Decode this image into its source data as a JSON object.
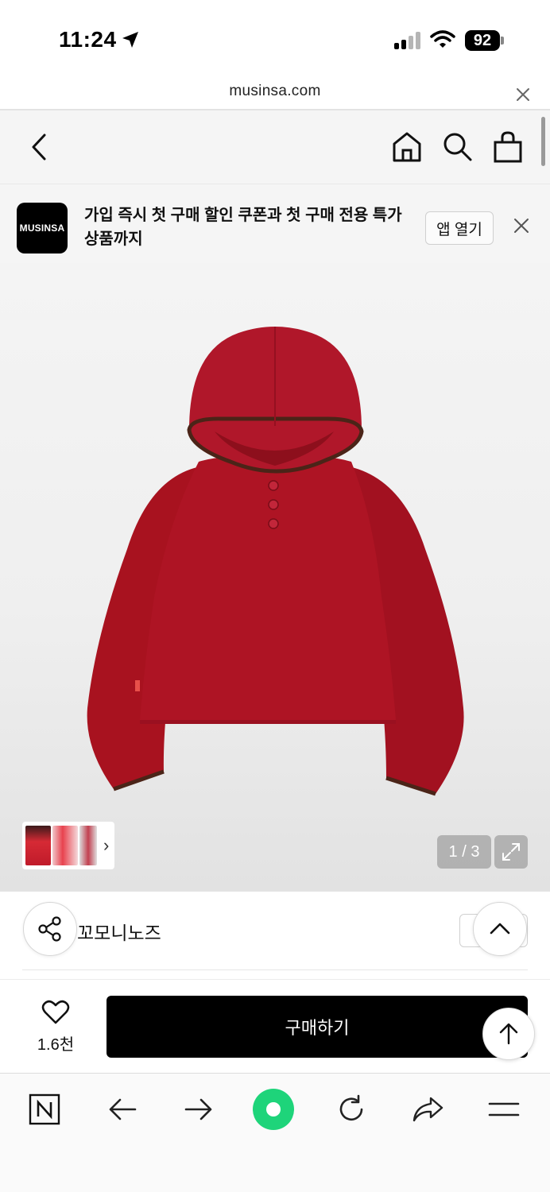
{
  "status_bar": {
    "time": "11:24",
    "battery": "92"
  },
  "browser": {
    "url": "musinsa.com"
  },
  "banner": {
    "logo_text": "MUSINSA",
    "message": "가입 즉시 첫 구매 할인 쿠폰과 첫 구매 전용 특가 상품까지",
    "open_app_label": "앱 열기"
  },
  "gallery": {
    "counter": "1 / 3"
  },
  "brand": {
    "name": "꼬모니노즈"
  },
  "purchase": {
    "like_count": "1.6천",
    "buy_label": "구매하기"
  },
  "colors": {
    "accent_green": "#1ed47a",
    "product_red": "#a8121f",
    "trim_brown": "#4b2418"
  },
  "icons": [
    "location-arrow-icon",
    "signal-icon",
    "wifi-icon",
    "back-chevron-icon",
    "home-icon",
    "search-icon",
    "bag-icon",
    "close-icon",
    "expand-icon",
    "share-icon",
    "chevron-up-icon",
    "heart-icon",
    "arrow-up-icon",
    "naver-icon",
    "arrow-left-icon",
    "arrow-right-icon",
    "reload-icon",
    "share-arrow-icon",
    "menu-icon"
  ]
}
